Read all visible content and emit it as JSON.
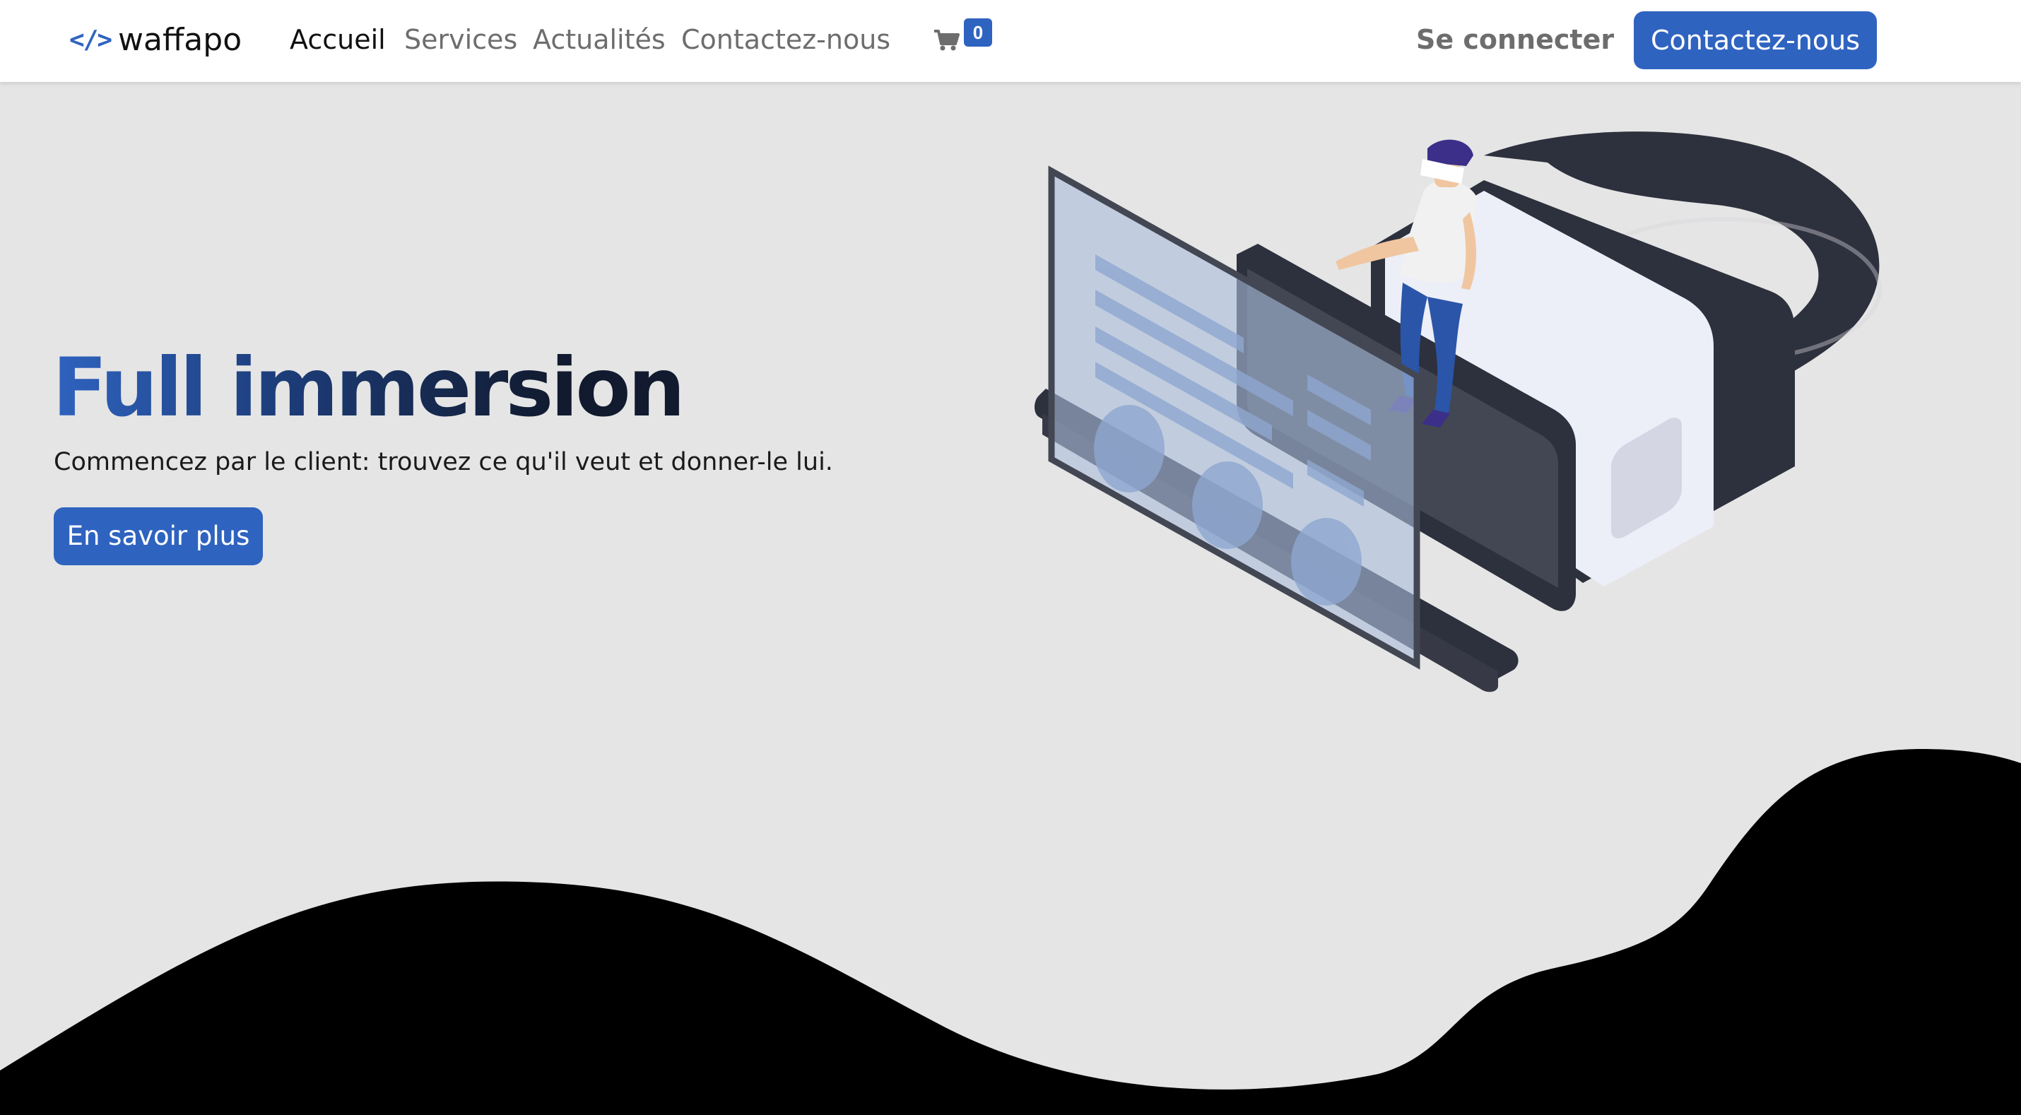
{
  "brand": {
    "icon": "code-icon",
    "glyph": "</>",
    "name": "waffapo",
    "accent": "#2f63c0"
  },
  "nav": {
    "links": [
      {
        "label": "Accueil",
        "active": true
      },
      {
        "label": "Services",
        "active": false
      },
      {
        "label": "Actualités",
        "active": false
      },
      {
        "label": "Contactez-nous",
        "active": false
      }
    ],
    "cart": {
      "icon": "cart-icon",
      "count": "0"
    },
    "login_label": "Se connecter",
    "cta_label": "Contactez-nous"
  },
  "hero": {
    "title": "Full immersion",
    "subtitle": "Commencez par le client: trouvez ce qu'il veut et donner-le lui.",
    "button_label": "En savoir plus",
    "illustration": "vr-headset-illustration"
  },
  "colors": {
    "primary": "#2f63c0",
    "background": "#e5e5e5",
    "wave": "#000000"
  }
}
